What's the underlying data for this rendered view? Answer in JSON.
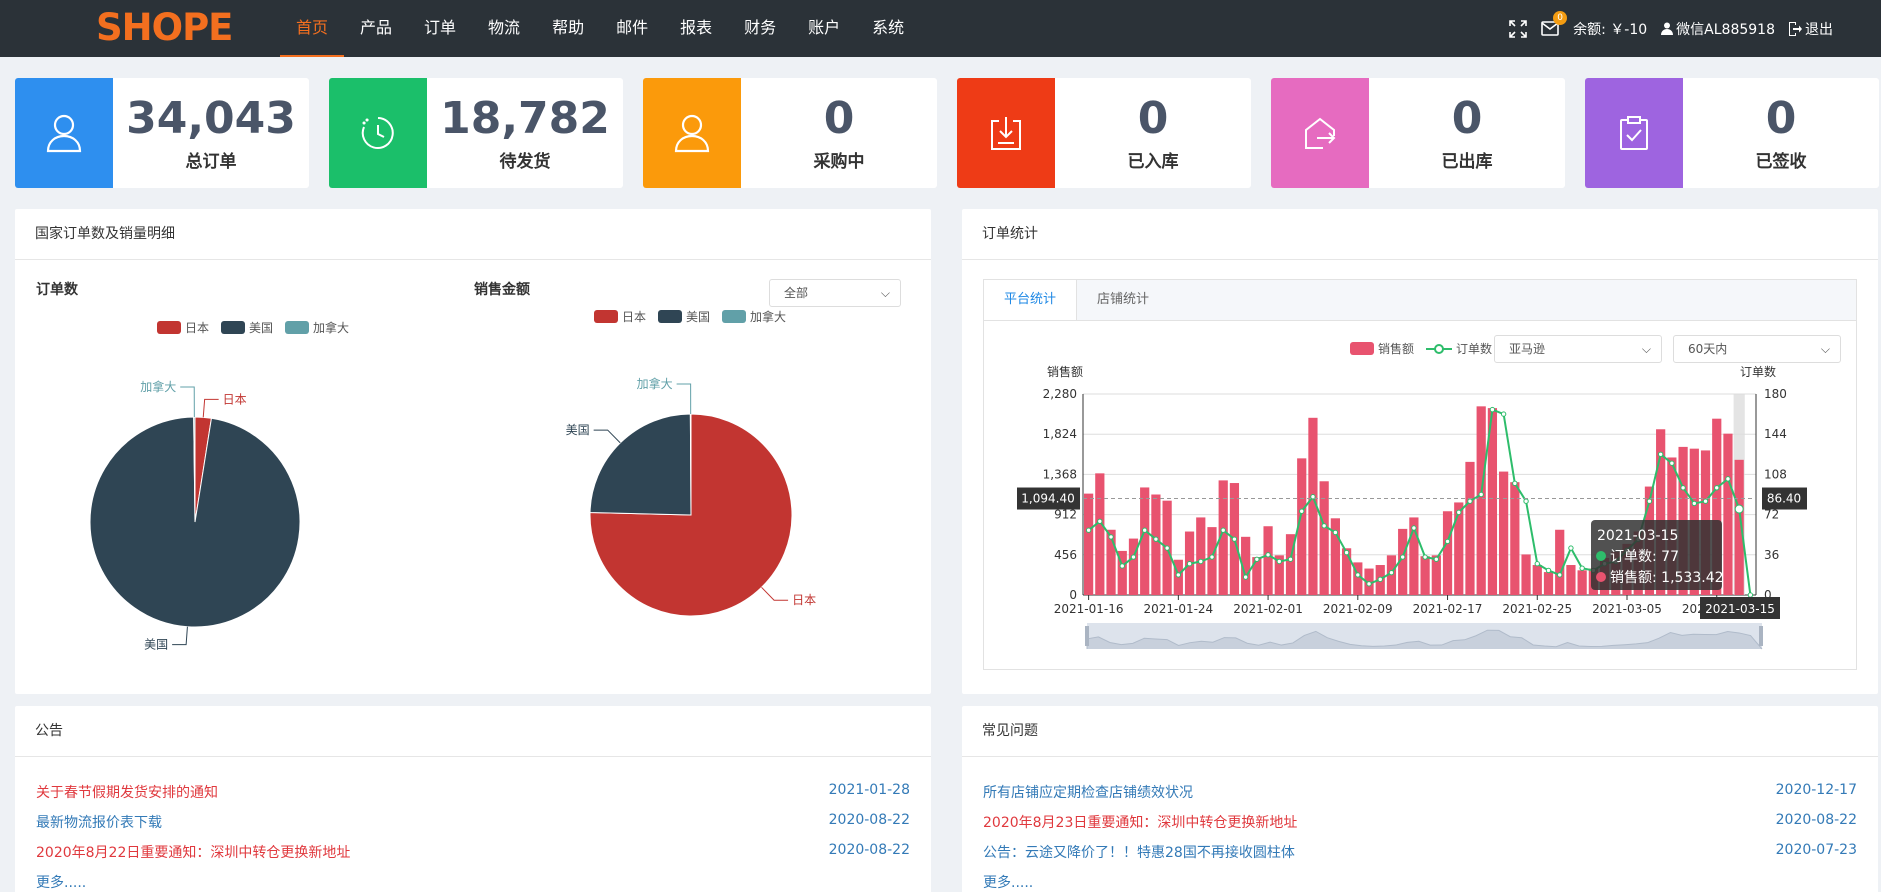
{
  "header": {
    "logo": "SHOPE",
    "nav": [
      "首页",
      "产品",
      "订单",
      "物流",
      "帮助",
      "邮件",
      "报表",
      "财务",
      "账户",
      "系统"
    ],
    "active_nav": "首页",
    "mail_badge": "0",
    "balance": "余额: ￥-10",
    "user": "微信AL885918",
    "logout": "退出"
  },
  "stats": [
    {
      "value": "34,043",
      "label": "总订单",
      "color": "#2e8fef",
      "icon": "user-icon"
    },
    {
      "value": "18,782",
      "label": "待发货",
      "color": "#1bbf6a",
      "icon": "clock-icon"
    },
    {
      "value": "0",
      "label": "采购中",
      "color": "#fb9a0b",
      "icon": "user-icon"
    },
    {
      "value": "0",
      "label": "已入库",
      "color": "#ee3b16",
      "icon": "download-box-icon"
    },
    {
      "value": "0",
      "label": "已出库",
      "color": "#e66bc0",
      "icon": "house-exit-icon"
    },
    {
      "value": "0",
      "label": "已签收",
      "color": "#9e64e0",
      "icon": "clipboard-check-icon"
    }
  ],
  "country_panel": {
    "title": "国家订单数及销量明细",
    "select": "全部",
    "colors": {
      "日本": "#c23531",
      "美国": "#2f4554",
      "加拿大": "#61a0a8"
    }
  },
  "chart_data": [
    {
      "type": "pie",
      "title": "订单数",
      "labels": [
        "日本",
        "美国",
        "加拿大"
      ],
      "values": [
        2.5,
        97.3,
        0.2
      ],
      "legend": "top-center"
    },
    {
      "type": "pie",
      "title": "销售金额",
      "labels": [
        "日本",
        "美国",
        "加拿大"
      ],
      "values": [
        75.4,
        24.5,
        0.1
      ],
      "legend": "top-center"
    },
    {
      "type": "bar",
      "x": [
        "2021-01-16",
        "2021-01-17",
        "2021-01-18",
        "2021-01-19",
        "2021-01-20",
        "2021-01-21",
        "2021-01-22",
        "2021-01-23",
        "2021-01-24",
        "2021-01-25",
        "2021-01-26",
        "2021-01-27",
        "2021-01-28",
        "2021-01-29",
        "2021-01-30",
        "2021-01-31",
        "2021-02-01",
        "2021-02-02",
        "2021-02-03",
        "2021-02-04",
        "2021-02-05",
        "2021-02-06",
        "2021-02-07",
        "2021-02-08",
        "2021-02-09",
        "2021-02-10",
        "2021-02-11",
        "2021-02-12",
        "2021-02-13",
        "2021-02-14",
        "2021-02-15",
        "2021-02-16",
        "2021-02-17",
        "2021-02-18",
        "2021-02-19",
        "2021-02-20",
        "2021-02-21",
        "2021-02-22",
        "2021-02-23",
        "2021-02-24",
        "2021-02-25",
        "2021-02-26",
        "2021-02-27",
        "2021-02-28",
        "2021-03-01",
        "2021-03-02",
        "2021-03-03",
        "2021-03-04",
        "2021-03-05",
        "2021-03-06",
        "2021-03-07",
        "2021-03-08",
        "2021-03-09",
        "2021-03-10",
        "2021-03-11",
        "2021-03-12",
        "2021-03-13",
        "2021-03-14",
        "2021-03-15",
        "2021-03-16"
      ],
      "series": [
        {
          "name": "销售额",
          "axis": "left",
          "values": [
            1150,
            1380,
            740,
            500,
            640,
            1220,
            1140,
            1070,
            400,
            720,
            880,
            770,
            1300,
            1270,
            660,
            430,
            780,
            450,
            690,
            1550,
            2010,
            1290,
            870,
            530,
            370,
            300,
            340,
            450,
            750,
            880,
            440,
            450,
            950,
            1050,
            1510,
            2140,
            2120,
            1400,
            1280,
            460,
            340,
            260,
            740,
            340,
            280,
            300,
            420,
            490,
            580,
            720,
            1230,
            1880,
            1560,
            1680,
            1660,
            1640,
            2000,
            1830,
            1533.42,
            0
          ]
        },
        {
          "name": "订单数",
          "axis": "right",
          "values": [
            58,
            66,
            52,
            26,
            34,
            58,
            50,
            42,
            18,
            28,
            30,
            34,
            58,
            50,
            16,
            32,
            36,
            30,
            32,
            75,
            88,
            62,
            56,
            38,
            18,
            10,
            14,
            20,
            34,
            60,
            34,
            32,
            48,
            74,
            84,
            90,
            166,
            162,
            100,
            84,
            28,
            22,
            18,
            42,
            24,
            22,
            28,
            30,
            40,
            50,
            84,
            126,
            118,
            96,
            82,
            84,
            96,
            104,
            77,
            0
          ]
        }
      ],
      "xticks": [
        "2021-01-16",
        "2021-01-24",
        "2021-02-01",
        "2021-02-09",
        "2021-02-17",
        "2021-02-25",
        "2021-03-05",
        "2021-03-13"
      ],
      "ylabel_left": "销售额",
      "ylabel_right": "订单数",
      "yticks_left": [
        "0",
        "456",
        "912",
        "1,368",
        "1,824",
        "2,280"
      ],
      "yticks_right": [
        "0",
        "36",
        "72",
        "108",
        "144",
        "180"
      ],
      "ylim_left": [
        0,
        2280
      ],
      "ylim_right": [
        0,
        180
      ],
      "grid": true,
      "legend": "top-right",
      "crosshair": {
        "date": "2021-03-15",
        "left_value": "1,094.40",
        "right_value": "86.40"
      },
      "tooltip": {
        "date": "2021-03-15",
        "orders": "订单数: 77",
        "sales": "销售额: 1,533.42"
      }
    }
  ],
  "order_panel": {
    "title": "订单统计",
    "tabs": [
      "平台统计",
      "店铺统计"
    ],
    "platform_select": "亚马逊",
    "range_select": "60天内",
    "legend_sales": "销售额",
    "legend_orders": "订单数"
  },
  "notice_panel": {
    "title": "公告",
    "items": [
      {
        "text": "关于春节假期发货安排的通知",
        "date": "2021-01-28",
        "color": "#e0393e"
      },
      {
        "text": "最新物流报价表下载",
        "date": "2020-08-22",
        "color": "#337ab7"
      },
      {
        "text": "2020年8月22日重要通知：深圳中转仓更换新地址",
        "date": "2020-08-22",
        "color": "#e0393e"
      }
    ],
    "more": "更多....."
  },
  "faq_panel": {
    "title": "常见问题",
    "items": [
      {
        "text": "所有店铺应定期检查店铺绩效状况",
        "date": "2020-12-17",
        "color": "#337ab7"
      },
      {
        "text": "2020年8月23日重要通知：深圳中转仓更换新地址",
        "date": "2020-08-22",
        "color": "#e0393e"
      },
      {
        "text": "公告：云途又降价了！！特惠28国不再接收圆柱体",
        "date": "2020-07-23",
        "color": "#337ab7"
      }
    ],
    "more": "更多....."
  }
}
